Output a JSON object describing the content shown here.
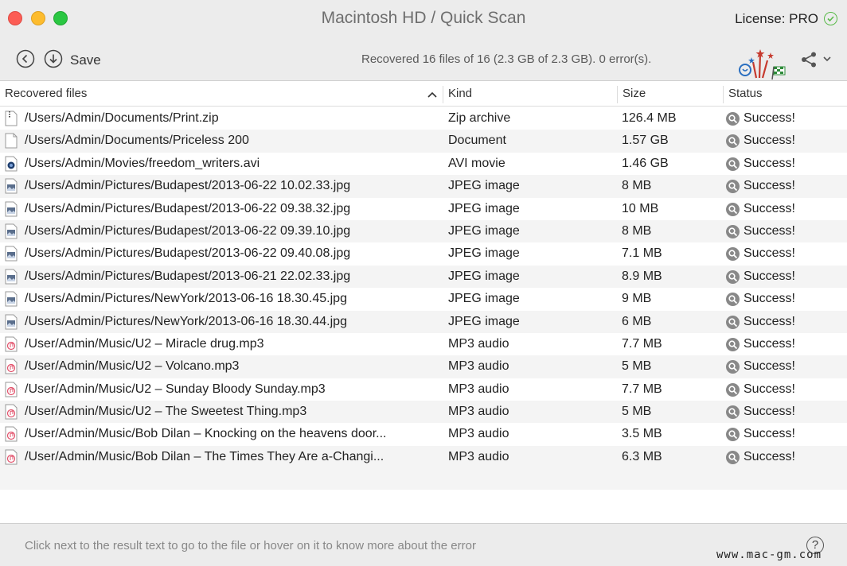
{
  "window": {
    "title": "Macintosh HD / Quick Scan",
    "license": "License: PRO"
  },
  "toolbar": {
    "save_label": "Save",
    "status": "Recovered 16 files of 16 (2.3 GB of 2.3 GB). 0 error(s)."
  },
  "table": {
    "headers": {
      "name": "Recovered files",
      "kind": "Kind",
      "size": "Size",
      "status": "Status"
    },
    "rows": [
      {
        "name": "/Users/Admin/Documents/Print.zip",
        "kind": "Zip archive",
        "size": "126.4 MB",
        "status": "Success!",
        "icon": "zip-file-icon"
      },
      {
        "name": "/Users/Admin/Documents/Priceless 200",
        "kind": "Document",
        "size": "1.57 GB",
        "status": "Success!",
        "icon": "document-file-icon"
      },
      {
        "name": "/Users/Admin/Movies/freedom_writers.avi",
        "kind": "AVI movie",
        "size": "1.46 GB",
        "status": "Success!",
        "icon": "movie-file-icon"
      },
      {
        "name": "/Users/Admin/Pictures/Budapest/2013-06-22 10.02.33.jpg",
        "kind": "JPEG image",
        "size": "8 MB",
        "status": "Success!",
        "icon": "image-file-icon"
      },
      {
        "name": "/Users/Admin/Pictures/Budapest/2013-06-22 09.38.32.jpg",
        "kind": "JPEG image",
        "size": "10 MB",
        "status": "Success!",
        "icon": "image-file-icon"
      },
      {
        "name": "/Users/Admin/Pictures/Budapest/2013-06-22 09.39.10.jpg",
        "kind": "JPEG image",
        "size": "8 MB",
        "status": "Success!",
        "icon": "image-file-icon"
      },
      {
        "name": "/Users/Admin/Pictures/Budapest/2013-06-22 09.40.08.jpg",
        "kind": "JPEG image",
        "size": "7.1 MB",
        "status": "Success!",
        "icon": "image-file-icon"
      },
      {
        "name": "/Users/Admin/Pictures/Budapest/2013-06-21 22.02.33.jpg",
        "kind": "JPEG image",
        "size": "8.9 MB",
        "status": "Success!",
        "icon": "image-file-icon"
      },
      {
        "name": "/Users/Admin/Pictures/NewYork/2013-06-16 18.30.45.jpg",
        "kind": "JPEG image",
        "size": "9 MB",
        "status": "Success!",
        "icon": "image-file-icon"
      },
      {
        "name": "/Users/Admin/Pictures/NewYork/2013-06-16 18.30.44.jpg",
        "kind": "JPEG image",
        "size": "6 MB",
        "status": "Success!",
        "icon": "image-file-icon"
      },
      {
        "name": "/User/Admin/Music/U2 – Miracle drug.mp3",
        "kind": "MP3 audio",
        "size": "7.7 MB",
        "status": "Success!",
        "icon": "audio-file-icon"
      },
      {
        "name": "/User/Admin/Music/U2 – Volcano.mp3",
        "kind": "MP3 audio",
        "size": "5 MB",
        "status": "Success!",
        "icon": "audio-file-icon"
      },
      {
        "name": "/User/Admin/Music/U2 – Sunday Bloody Sunday.mp3",
        "kind": "MP3 audio",
        "size": "7.7 MB",
        "status": "Success!",
        "icon": "audio-file-icon"
      },
      {
        "name": "/User/Admin/Music/U2 – The Sweetest Thing.mp3",
        "kind": "MP3 audio",
        "size": "5 MB",
        "status": "Success!",
        "icon": "audio-file-icon"
      },
      {
        "name": "/User/Admin/Music/Bob Dilan – Knocking on the heavens door...",
        "kind": "MP3 audio",
        "size": "3.5 MB",
        "status": "Success!",
        "icon": "audio-file-icon"
      },
      {
        "name": "/User/Admin/Music/Bob Dilan – The Times They Are a-Changi...",
        "kind": "MP3 audio",
        "size": "6.3 MB",
        "status": "Success!",
        "icon": "audio-file-icon"
      }
    ]
  },
  "footer": {
    "hint": "Click next to the result text to go to the file or hover on it to know more about the error",
    "help": "?"
  },
  "watermark": "www.mac-gm.com",
  "colors": {
    "close": "#fc5d55",
    "minimize": "#fdbc2e",
    "zoom": "#2ac742",
    "license_check": "#5aba4a",
    "row_alt": "#f4f4f4"
  }
}
